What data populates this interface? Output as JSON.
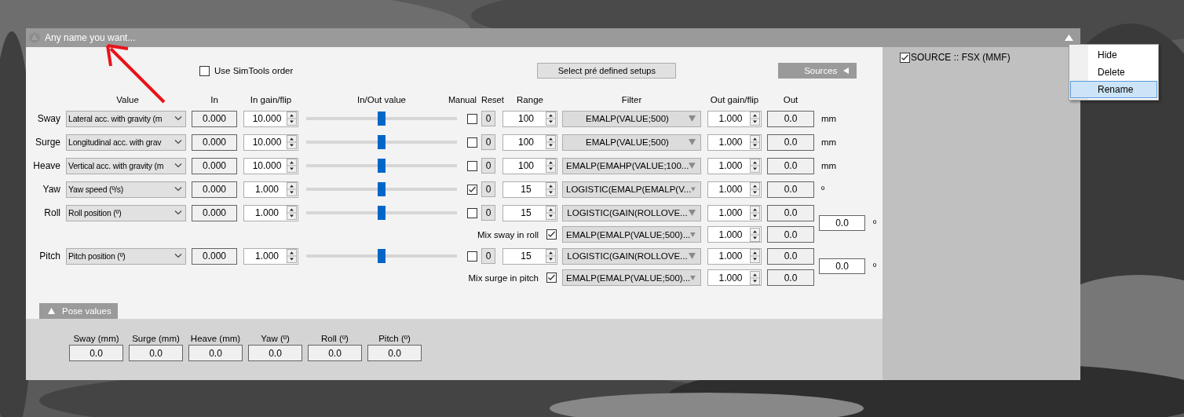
{
  "window": {
    "title": "Any name you want..."
  },
  "options": {
    "use_simtools_order": {
      "label": "Use SimTools order",
      "checked": false
    },
    "setups_button": "Select pré defined setups",
    "sources_tab": "Sources"
  },
  "columns": [
    "Value",
    "In",
    "In gain/flip",
    "In/Out value",
    "Manual",
    "Reset",
    "Range",
    "Filter",
    "Out gain/flip",
    "Out"
  ],
  "axes": [
    {
      "name": "Sway",
      "value": "Lateral acc. with gravity (m",
      "in": "0.000",
      "in_gain": "10.000",
      "level": 0.5,
      "manual": false,
      "reset": "0",
      "range": "100",
      "filter": "EMALP(VALUE;500)",
      "out_gain": "1.000",
      "out": "0.0",
      "unit": "mm"
    },
    {
      "name": "Surge",
      "value": "Longitudinal acc. with grav",
      "in": "0.000",
      "in_gain": "10.000",
      "level": 0.5,
      "manual": false,
      "reset": "0",
      "range": "100",
      "filter": "EMALP(VALUE;500)",
      "out_gain": "1.000",
      "out": "0.0",
      "unit": "mm"
    },
    {
      "name": "Heave",
      "value": "Vertical acc. with gravity (m",
      "in": "0.000",
      "in_gain": "10.000",
      "level": 0.5,
      "manual": false,
      "reset": "0",
      "range": "100",
      "filter": "EMALP(EMAHP(VALUE;100...",
      "out_gain": "1.000",
      "out": "0.0",
      "unit": "mm"
    },
    {
      "name": "Yaw",
      "value": "Yaw speed (º/s)",
      "in": "0.000",
      "in_gain": "1.000",
      "level": 0.5,
      "manual": true,
      "reset": "0",
      "range": "15",
      "filter": "LOGISTIC(EMALP(EMALP(V...",
      "out_gain": "1.000",
      "out": "0.0",
      "unit": "º"
    },
    {
      "name": "Roll",
      "value": "Roll position (º)",
      "in": "0.000",
      "in_gain": "1.000",
      "level": 0.5,
      "manual": false,
      "reset": "0",
      "range": "15",
      "filter": "LOGISTIC(GAIN(ROLLOVE...",
      "out_gain": "1.000",
      "out": "0.0",
      "mix": {
        "label": "Mix sway in roll",
        "checked": true,
        "filter": "EMALP(EMALP(VALUE;500)...",
        "out_gain": "1.000",
        "out": "0.0"
      },
      "combined": {
        "value": "0.0",
        "unit": "º"
      }
    },
    {
      "name": "Pitch",
      "value": "Pitch position (º)",
      "in": "0.000",
      "in_gain": "1.000",
      "level": 0.5,
      "manual": false,
      "reset": "0",
      "range": "15",
      "filter": "LOGISTIC(GAIN(ROLLOVE...",
      "out_gain": "1.000",
      "out": "0.0",
      "mix": {
        "label": "Mix surge in pitch",
        "checked": true,
        "filter": "EMALP(EMALP(VALUE;500)...",
        "out_gain": "1.000",
        "out": "0.0"
      },
      "combined": {
        "value": "0.0",
        "unit": "º"
      }
    }
  ],
  "pose_values": {
    "title": "Pose values",
    "fields": [
      {
        "label": "Sway (mm)",
        "value": "0.0"
      },
      {
        "label": "Surge (mm)",
        "value": "0.0"
      },
      {
        "label": "Heave (mm)",
        "value": "0.0"
      },
      {
        "label": "Yaw (º)",
        "value": "0.0"
      },
      {
        "label": "Roll (º)",
        "value": "0.0"
      },
      {
        "label": "Pitch (º)",
        "value": "0.0"
      }
    ]
  },
  "sources": [
    {
      "label": "SOURCE :: FSX (MMF)",
      "checked": true
    }
  ],
  "context_menu": [
    {
      "label": "Hide",
      "selected": false
    },
    {
      "label": "Delete",
      "selected": false
    },
    {
      "label": "Rename",
      "selected": true
    }
  ]
}
